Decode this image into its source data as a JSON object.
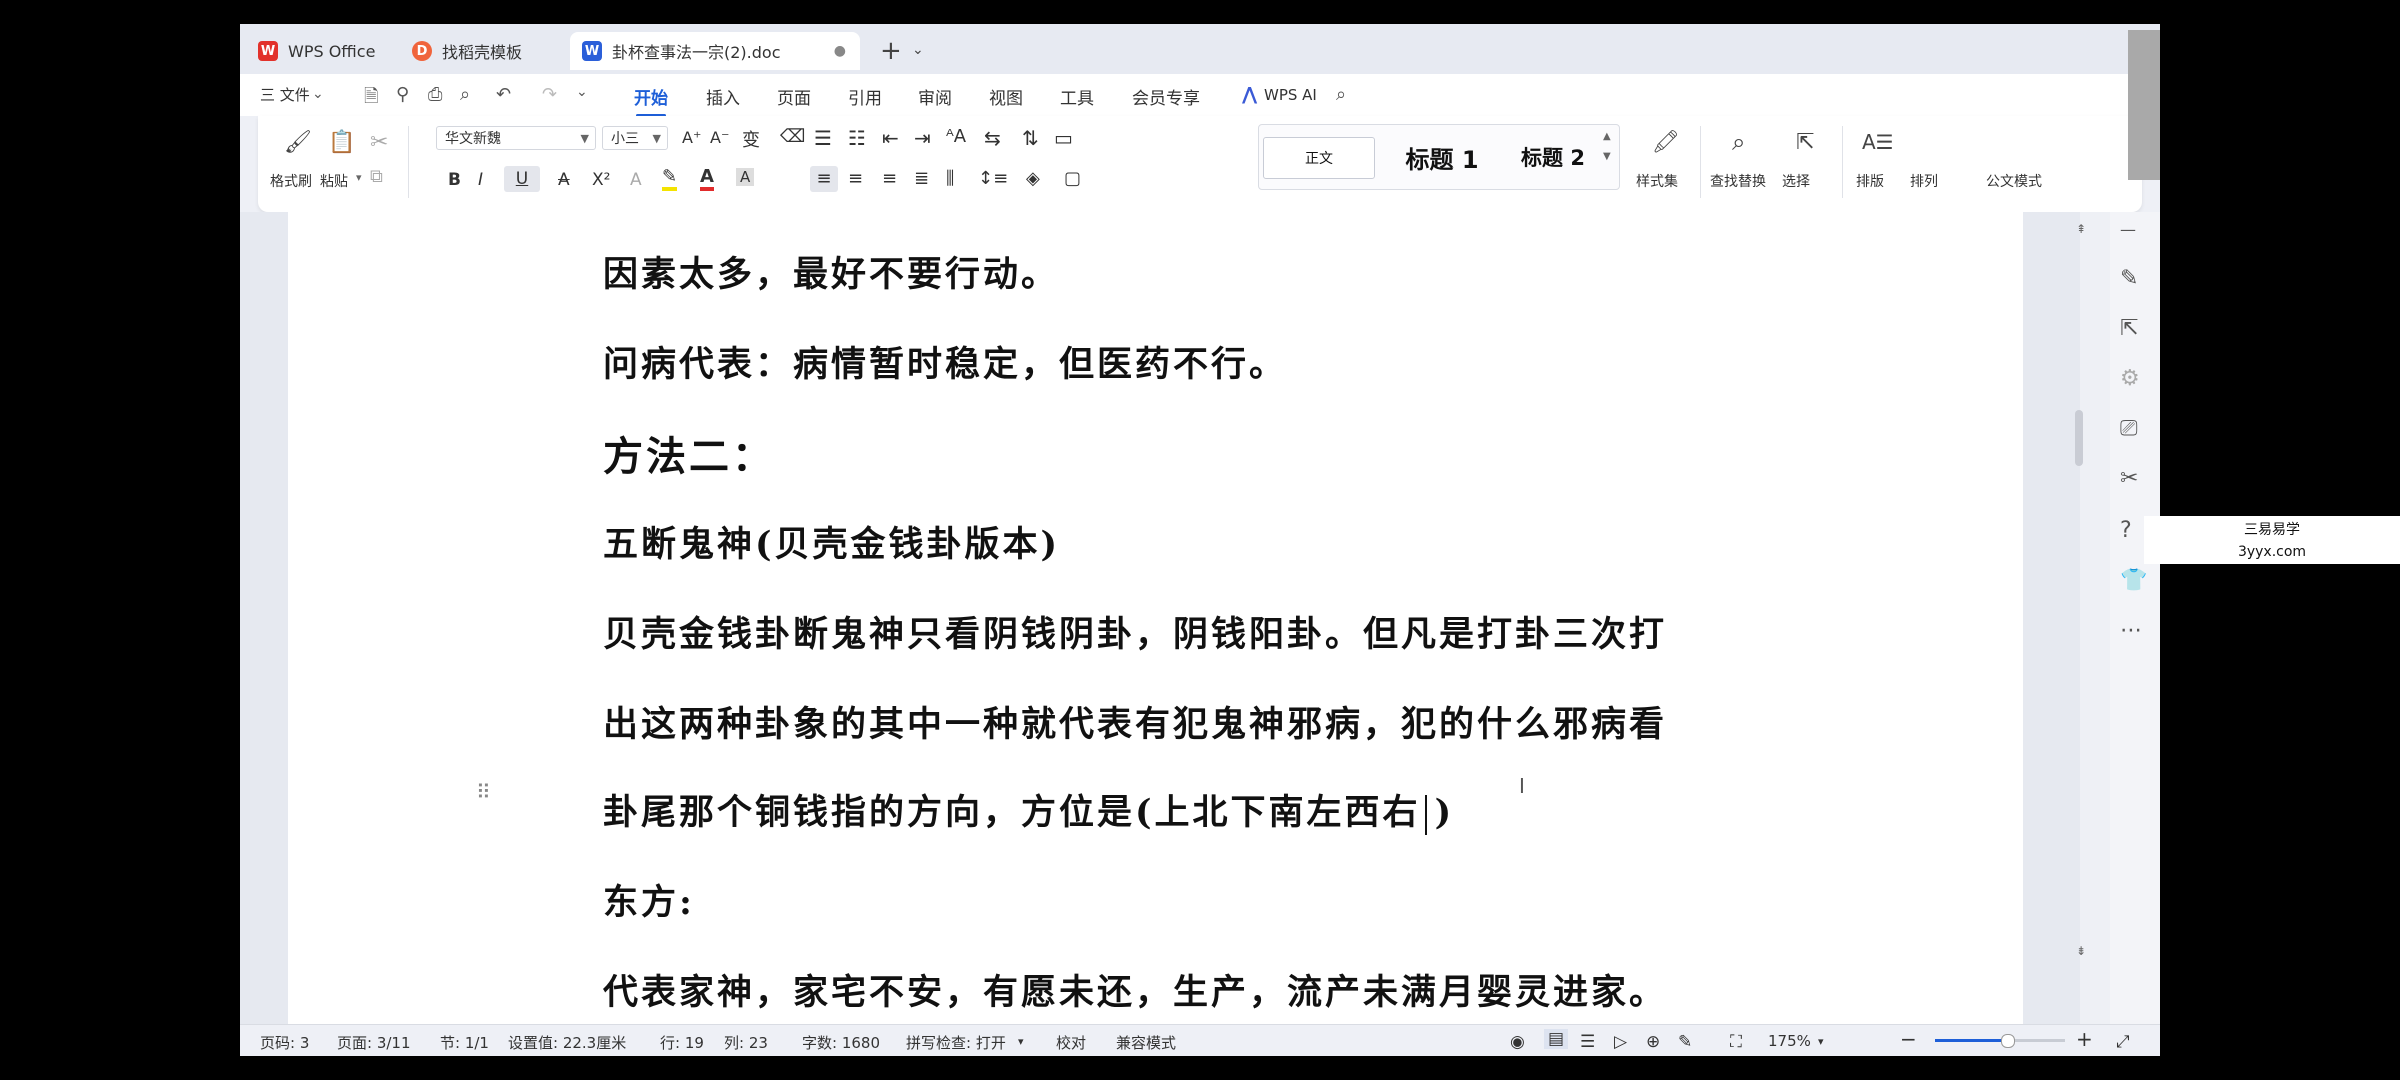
{
  "tabs": [
    {
      "label": "WPS Office"
    },
    {
      "label": "找稻壳模板"
    },
    {
      "label": "卦杯查事法一宗(2).doc"
    }
  ],
  "menu": {
    "file": "三 文件",
    "items": [
      "开始",
      "插入",
      "页面",
      "引用",
      "审阅",
      "视图",
      "工具",
      "会员专享"
    ],
    "ai": "WPS AI"
  },
  "ribbon": {
    "format_painter": "格式刷",
    "paste": "粘贴",
    "font_name": "华文新魏",
    "font_size": "小三",
    "styles": [
      "正文",
      "标题 1",
      "标题 2"
    ],
    "style_set": "样式集",
    "find_replace": "查找替换",
    "select": "选择",
    "layout": "排版",
    "arrange": "排列",
    "official_mode": "公文模式"
  },
  "document": {
    "paragraphs": [
      "因素太多，最好不要行动。",
      "问病代表：病情暂时稳定，但医药不行。",
      "方法二：",
      "五断鬼神(贝壳金钱卦版本)",
      "贝壳金钱卦断鬼神只看阴钱阴卦，阴钱阳卦。但凡是打卦三次打",
      "出这两种卦象的其中一种就代表有犯鬼神邪病，犯的什么邪病看",
      "卦尾那个铜钱指的方向，方位是(上北下南左西右",
      ")",
      "东方:",
      "代表家神，家宅不安，有愿未还，生产，流产未满月婴灵进家。"
    ]
  },
  "status": {
    "page_code": "页码: 3",
    "page": "页面: 3/11",
    "section": "节: 1/1",
    "setting": "设置值: 22.3厘米",
    "row": "行: 19",
    "col": "列: 23",
    "words": "字数: 1680",
    "spell": "拼写检查: 打开",
    "proof": "校对",
    "compat": "兼容模式",
    "zoom": "175%",
    "zoom_fraction": 0.55
  },
  "watermark": {
    "line1": "三易易学",
    "line2": "3yyx.com"
  },
  "colors": {
    "accent": "#1e5fd8",
    "wps_red": "#e2312b",
    "doc_blue": "#2b5fd9"
  }
}
